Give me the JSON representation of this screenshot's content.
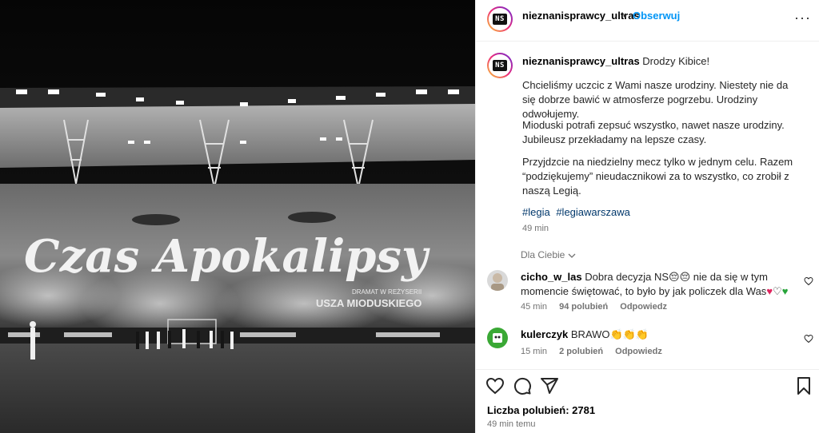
{
  "post": {
    "username": "nieznanisprawcy_ultras",
    "dot": "•",
    "follow_label": "Obserwuj",
    "more_label": "···",
    "avatar_logo": "NS",
    "image_banner_text": "Czas Apokalipsy",
    "image_small_text_1": "DRAMAT W REŻYSERII",
    "image_small_text_2": "USZA MIODUSKIEGO"
  },
  "caption": {
    "username": "nieznanisprawcy_ultras",
    "first_line": "Drodzy Kibice!",
    "paragraphs": [
      "Chcieliśmy uczcic z Wami nasze urodziny. Niestety nie da się dobrze bawić w atmosferze pogrzebu. Urodziny odwołujemy.",
      "Mioduski potrafi zepsuć wszystko, nawet nasze urodziny. Jubileusz przekładamy na lepsze czasy.",
      "Przyjdzcie na niedzielny mecz tylko w jednym celu. Razem “podziękujemy” nieudacznikowi za to wszystko, co zrobił z naszą Legią."
    ],
    "hashtags": [
      "#legia",
      "#legiawarszawa"
    ],
    "time": "49 min"
  },
  "filter": {
    "label": "Dla Ciebie",
    "icon": "chevron-down-icon"
  },
  "comments": [
    {
      "username": "cicho_w_las",
      "text_part1": "Dobra decyzja NS",
      "emoji1": "😔😔",
      "text_part2": "nie da się w tym momencie świętować, to było by jak policzek dla Was",
      "emoji2": "♥",
      "emoji3": "♡",
      "emoji4": "♥",
      "time": "45 min",
      "likes": "94 polubień",
      "reply": "Odpowiedz"
    },
    {
      "username": "kulerczyk",
      "text_part1": "BRAWO",
      "emoji1": "👏👏👏",
      "time": "15 min",
      "likes": "2 polubień",
      "reply": "Odpowiedz"
    }
  ],
  "actions": {
    "icons": [
      "heart-icon",
      "comment-icon",
      "share-icon",
      "bookmark-icon"
    ]
  },
  "likes_label": "Liczba polubień: 2781",
  "time_ago": "49 min temu",
  "colors": {
    "accent": "#0095f6",
    "hashtag": "#00376b",
    "muted": "#737373",
    "border": "#efefef"
  }
}
